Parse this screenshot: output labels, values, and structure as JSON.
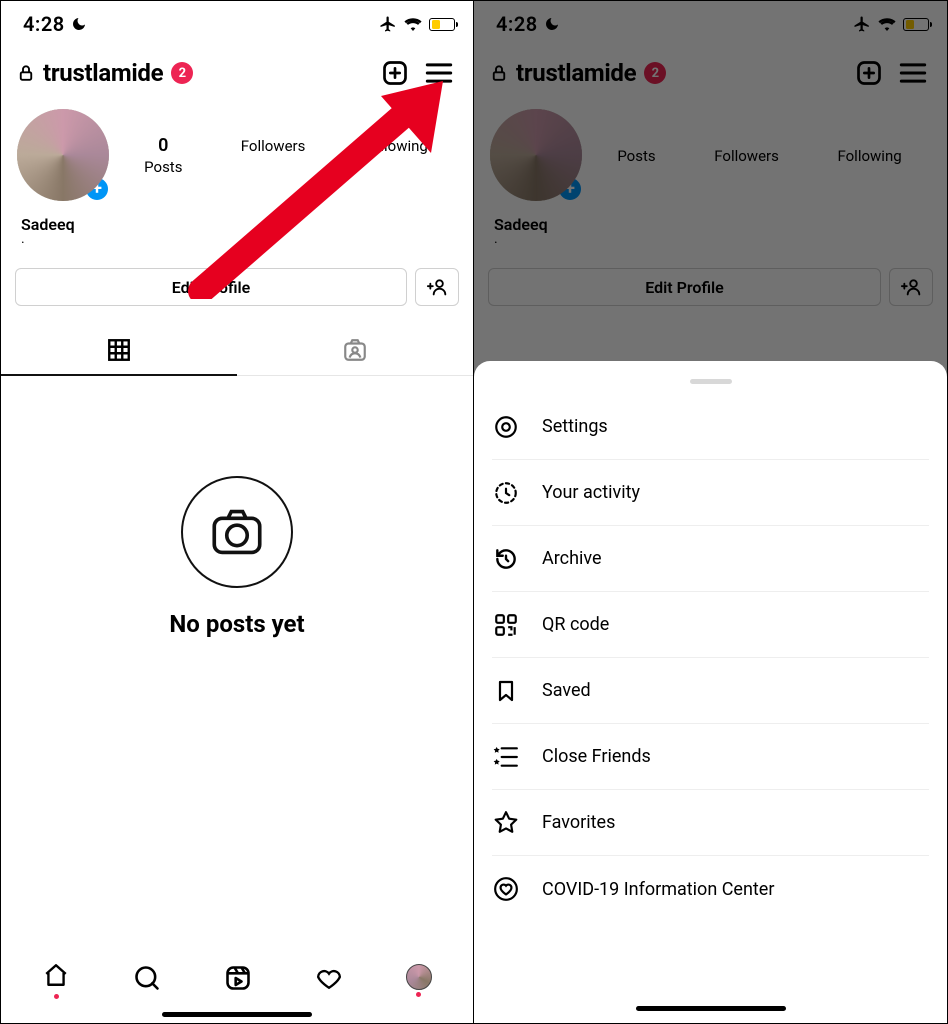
{
  "status": {
    "time": "4:28"
  },
  "header": {
    "username": "trustlamide",
    "notif_count": "2"
  },
  "stats": {
    "posts_num": "0",
    "posts_label": "Posts",
    "followers_label": "Followers",
    "following_label": "Following"
  },
  "profile": {
    "display_name": "Sadeeq",
    "bio_dot": ".",
    "edit_button": "Edit Profile"
  },
  "empty_feed": {
    "title": "No posts yet"
  },
  "menu": {
    "items": [
      "Settings",
      "Your activity",
      "Archive",
      "QR code",
      "Saved",
      "Close Friends",
      "Favorites",
      "COVID-19 Information Center"
    ]
  }
}
